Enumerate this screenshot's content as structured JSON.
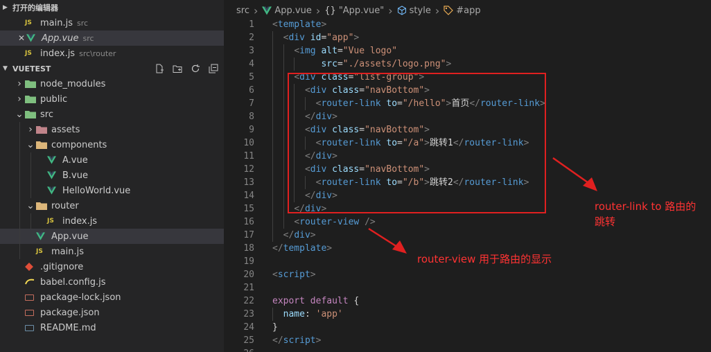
{
  "sidebar": {
    "open_editors": {
      "title": "打开的编辑器",
      "items": [
        {
          "icon": "js-icon",
          "icon_text": "JS",
          "name": "main.js",
          "desc": "src",
          "selected": false,
          "italic": false,
          "close": false
        },
        {
          "icon": "vue-icon",
          "name": "App.vue",
          "desc": "src",
          "selected": true,
          "italic": true,
          "close": true
        },
        {
          "icon": "js-icon",
          "icon_text": "JS",
          "name": "index.js",
          "desc": "src\\router",
          "selected": false,
          "italic": false,
          "close": false
        }
      ]
    },
    "explorer": {
      "title": "VUETEST",
      "actions": [
        "new-file-icon",
        "new-folder-icon",
        "refresh-icon",
        "collapse-all-icon"
      ],
      "tree": [
        {
          "name": "node_modules",
          "depth": 0,
          "type": "folder",
          "expanded": false,
          "color": "#7fbf7f"
        },
        {
          "name": "public",
          "depth": 0,
          "type": "folder",
          "expanded": false,
          "color": "#7fbf7f"
        },
        {
          "name": "src",
          "depth": 0,
          "type": "folder",
          "expanded": true,
          "color": "#7fbf7f"
        },
        {
          "name": "assets",
          "depth": 1,
          "type": "folder",
          "expanded": false,
          "color": "#c0848a"
        },
        {
          "name": "components",
          "depth": 1,
          "type": "folder",
          "expanded": true,
          "color": "#dcb67a"
        },
        {
          "name": "A.vue",
          "depth": 2,
          "type": "vue"
        },
        {
          "name": "B.vue",
          "depth": 2,
          "type": "vue"
        },
        {
          "name": "HelloWorld.vue",
          "depth": 2,
          "type": "vue"
        },
        {
          "name": "router",
          "depth": 1,
          "type": "folder",
          "expanded": true,
          "color": "#dcb67a"
        },
        {
          "name": "index.js",
          "depth": 2,
          "type": "js",
          "icon_text": "JS"
        },
        {
          "name": "App.vue",
          "depth": 1,
          "type": "vue",
          "selected": true
        },
        {
          "name": "main.js",
          "depth": 1,
          "type": "js",
          "icon_text": "JS"
        },
        {
          "name": ".gitignore",
          "depth": 0,
          "type": "git"
        },
        {
          "name": "babel.config.js",
          "depth": 0,
          "type": "babel"
        },
        {
          "name": "package-lock.json",
          "depth": 0,
          "type": "npm"
        },
        {
          "name": "package.json",
          "depth": 0,
          "type": "npm"
        },
        {
          "name": "README.md",
          "depth": 0,
          "type": "md"
        }
      ]
    }
  },
  "breadcrumb": {
    "items": [
      {
        "icon": "",
        "label": "src"
      },
      {
        "icon": "vue-icon",
        "label": "App.vue"
      },
      {
        "icon": "braces-icon",
        "label": "\"App.vue\""
      },
      {
        "icon": "cube-icon",
        "label": "style"
      },
      {
        "icon": "tag-icon",
        "label": "#app"
      }
    ]
  },
  "code": {
    "lines": [
      {
        "n": "1",
        "indent": 0,
        "tokens": [
          [
            "b",
            "<"
          ],
          [
            "t",
            "template"
          ],
          [
            "b",
            ">"
          ]
        ]
      },
      {
        "n": "2",
        "indent": 1,
        "tokens": [
          [
            "b",
            "<"
          ],
          [
            "t",
            "div"
          ],
          [
            "x",
            " "
          ],
          [
            "a",
            "id"
          ],
          [
            "x",
            "="
          ],
          [
            "s",
            "\"app\""
          ],
          [
            "b",
            ">"
          ]
        ]
      },
      {
        "n": "3",
        "indent": 2,
        "tokens": [
          [
            "b",
            "<"
          ],
          [
            "t",
            "img"
          ],
          [
            "x",
            " "
          ],
          [
            "a",
            "alt"
          ],
          [
            "x",
            "="
          ],
          [
            "s",
            "\"Vue logo\""
          ]
        ]
      },
      {
        "n": "4",
        "indent": 3,
        "tokens": [
          [
            "x",
            "   "
          ],
          [
            "a",
            "src"
          ],
          [
            "x",
            "="
          ],
          [
            "s",
            "\"./assets/logo.png\""
          ],
          [
            "b",
            ">"
          ]
        ]
      },
      {
        "n": "5",
        "indent": 2,
        "tokens": [
          [
            "b",
            "<"
          ],
          [
            "t",
            "div"
          ],
          [
            "x",
            " "
          ],
          [
            "a",
            "class"
          ],
          [
            "x",
            "="
          ],
          [
            "s",
            "\"list-group\""
          ],
          [
            "b",
            ">"
          ]
        ]
      },
      {
        "n": "6",
        "indent": 3,
        "tokens": [
          [
            "b",
            "<"
          ],
          [
            "t",
            "div"
          ],
          [
            "x",
            " "
          ],
          [
            "a",
            "class"
          ],
          [
            "x",
            "="
          ],
          [
            "s",
            "\"navBottom\""
          ],
          [
            "b",
            ">"
          ]
        ]
      },
      {
        "n": "7",
        "indent": 4,
        "tokens": [
          [
            "b",
            "<"
          ],
          [
            "t",
            "router-link"
          ],
          [
            "x",
            " "
          ],
          [
            "a",
            "to"
          ],
          [
            "x",
            "="
          ],
          [
            "s",
            "\"/hello\""
          ],
          [
            "b",
            ">"
          ],
          [
            "x",
            "首页"
          ],
          [
            "b",
            "</"
          ],
          [
            "t",
            "router-link"
          ],
          [
            "b",
            ">"
          ]
        ]
      },
      {
        "n": "8",
        "indent": 3,
        "tokens": [
          [
            "b",
            "</"
          ],
          [
            "t",
            "div"
          ],
          [
            "b",
            ">"
          ]
        ]
      },
      {
        "n": "9",
        "indent": 3,
        "tokens": [
          [
            "b",
            "<"
          ],
          [
            "t",
            "div"
          ],
          [
            "x",
            " "
          ],
          [
            "a",
            "class"
          ],
          [
            "x",
            "="
          ],
          [
            "s",
            "\"navBottom\""
          ],
          [
            "b",
            ">"
          ]
        ]
      },
      {
        "n": "10",
        "indent": 4,
        "tokens": [
          [
            "b",
            "<"
          ],
          [
            "t",
            "router-link"
          ],
          [
            "x",
            " "
          ],
          [
            "a",
            "to"
          ],
          [
            "x",
            "="
          ],
          [
            "s",
            "\"/a\""
          ],
          [
            "b",
            ">"
          ],
          [
            "x",
            "跳转1"
          ],
          [
            "b",
            "</"
          ],
          [
            "t",
            "router-link"
          ],
          [
            "b",
            ">"
          ]
        ]
      },
      {
        "n": "11",
        "indent": 3,
        "tokens": [
          [
            "b",
            "</"
          ],
          [
            "t",
            "div"
          ],
          [
            "b",
            ">"
          ]
        ]
      },
      {
        "n": "12",
        "indent": 3,
        "tokens": [
          [
            "b",
            "<"
          ],
          [
            "t",
            "div"
          ],
          [
            "x",
            " "
          ],
          [
            "a",
            "class"
          ],
          [
            "x",
            "="
          ],
          [
            "s",
            "\"navBottom\""
          ],
          [
            "b",
            ">"
          ]
        ]
      },
      {
        "n": "13",
        "indent": 4,
        "tokens": [
          [
            "b",
            "<"
          ],
          [
            "t",
            "router-link"
          ],
          [
            "x",
            " "
          ],
          [
            "a",
            "to"
          ],
          [
            "x",
            "="
          ],
          [
            "s",
            "\"/b\""
          ],
          [
            "b",
            ">"
          ],
          [
            "x",
            "跳转2"
          ],
          [
            "b",
            "</"
          ],
          [
            "t",
            "router-link"
          ],
          [
            "b",
            ">"
          ]
        ]
      },
      {
        "n": "14",
        "indent": 3,
        "tokens": [
          [
            "b",
            "</"
          ],
          [
            "t",
            "div"
          ],
          [
            "b",
            ">"
          ]
        ]
      },
      {
        "n": "15",
        "indent": 2,
        "tokens": [
          [
            "b",
            "</"
          ],
          [
            "t",
            "div"
          ],
          [
            "b",
            ">"
          ]
        ]
      },
      {
        "n": "16",
        "indent": 2,
        "tokens": [
          [
            "b",
            "<"
          ],
          [
            "t",
            "router-view"
          ],
          [
            "x",
            " "
          ],
          [
            "b",
            "/>"
          ]
        ]
      },
      {
        "n": "17",
        "indent": 1,
        "tokens": [
          [
            "b",
            "</"
          ],
          [
            "t",
            "div"
          ],
          [
            "b",
            ">"
          ]
        ]
      },
      {
        "n": "18",
        "indent": 0,
        "tokens": [
          [
            "b",
            "</"
          ],
          [
            "t",
            "template"
          ],
          [
            "b",
            ">"
          ]
        ]
      },
      {
        "n": "19",
        "indent": 0,
        "tokens": []
      },
      {
        "n": "20",
        "indent": 0,
        "tokens": [
          [
            "b",
            "<"
          ],
          [
            "t",
            "script"
          ],
          [
            "b",
            ">"
          ]
        ]
      },
      {
        "n": "21",
        "indent": 0,
        "tokens": []
      },
      {
        "n": "22",
        "indent": 0,
        "tokens": [
          [
            "k",
            "export"
          ],
          [
            "x",
            " "
          ],
          [
            "k",
            "default"
          ],
          [
            "x",
            " {"
          ]
        ]
      },
      {
        "n": "23",
        "indent": 1,
        "tokens": [
          [
            "a",
            "name"
          ],
          [
            "x",
            ": "
          ],
          [
            "s",
            "'app'"
          ]
        ]
      },
      {
        "n": "24",
        "indent": 0,
        "tokens": [
          [
            "x",
            "}"
          ]
        ]
      },
      {
        "n": "25",
        "indent": 0,
        "tokens": [
          [
            "b",
            "</"
          ],
          [
            "t",
            "script"
          ],
          [
            "b",
            ">"
          ]
        ]
      },
      {
        "n": "26",
        "indent": 0,
        "tokens": []
      }
    ]
  },
  "annotations": {
    "router_link_note": [
      "router-link to 路由的",
      "跳转"
    ],
    "router_view_note": "router-view 用于路由的显示",
    "color": "#e02020"
  }
}
